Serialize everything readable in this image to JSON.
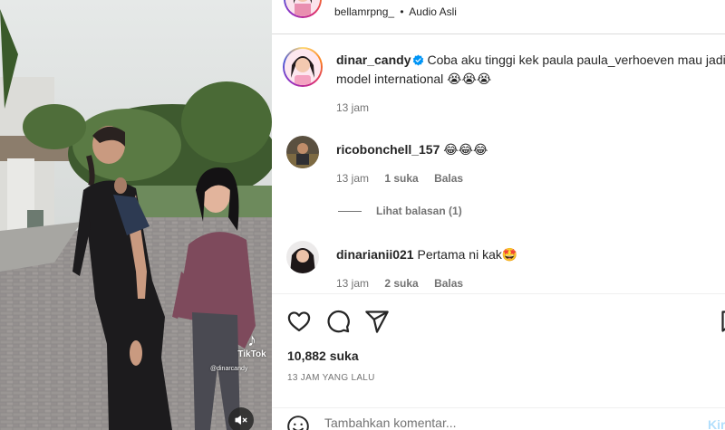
{
  "header": {
    "account": "bellamrpng_",
    "separator": "•",
    "audio_label": "Audio Asli"
  },
  "caption": {
    "username": "dinar_candy",
    "verified": true,
    "text": "Coba aku tinggi kek paula paula_verhoeven mau jadi model international 😭😭😭",
    "time": "13 jam"
  },
  "comments": [
    {
      "username": "ricobonchell_157",
      "text": "😂😂😂",
      "time": "13 jam",
      "likes": "1 suka",
      "reply": "Balas",
      "view_replies": "Lihat balasan (1)"
    },
    {
      "username": "dinarianii021",
      "text": "Pertama ni kak🤩",
      "time": "13 jam",
      "likes": "2 suka",
      "reply": "Balas"
    }
  ],
  "actions": {
    "like_icon": "heart-icon",
    "comment_icon": "comment-icon",
    "share_icon": "send-icon",
    "save_icon": "bookmark-icon"
  },
  "likes_count": "10,882 suka",
  "time_ago": "13 JAM YANG LALU",
  "composer": {
    "emoji_icon": "emoji-icon",
    "placeholder": "Tambahkan komentar...",
    "post_label": "Kirim"
  },
  "media": {
    "watermark": "TikTok",
    "watermark_handle": "@dinarcandy",
    "mute_icon": "muted-speaker-icon"
  }
}
